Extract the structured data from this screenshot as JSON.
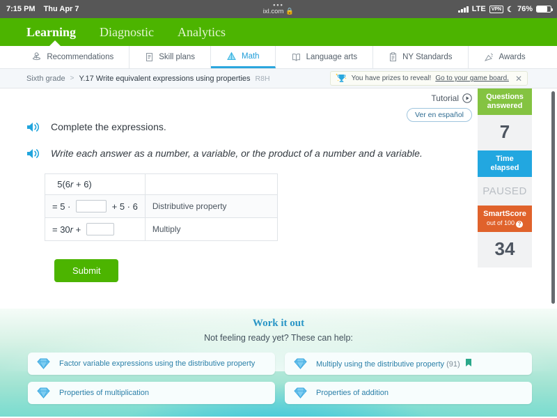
{
  "status_bar": {
    "time": "7:15 PM",
    "date": "Thu Apr 7",
    "url": "ixl.com",
    "lock_icon": "🔒",
    "network": "LTE",
    "vpn": "VPN",
    "moon_icon": "☾",
    "battery": "76%"
  },
  "top_nav": {
    "items": [
      {
        "label": "Learning",
        "active": true
      },
      {
        "label": "Diagnostic",
        "active": false
      },
      {
        "label": "Analytics",
        "active": false
      }
    ]
  },
  "subject_tabs": [
    {
      "label": "Recommendations",
      "icon": "recommendations-icon",
      "active": false
    },
    {
      "label": "Skill plans",
      "icon": "skill-plans-icon",
      "active": false
    },
    {
      "label": "Math",
      "icon": "math-icon",
      "active": true
    },
    {
      "label": "Language arts",
      "icon": "language-arts-icon",
      "active": false
    },
    {
      "label": "NY Standards",
      "icon": "standards-icon",
      "active": false
    },
    {
      "label": "Awards",
      "icon": "awards-icon",
      "active": false
    }
  ],
  "breadcrumb": {
    "grade": "Sixth grade",
    "separator": ">",
    "skill": "Y.17 Write equivalent expressions using properties",
    "code": "R8H"
  },
  "prize_banner": {
    "icon": "trophy-icon",
    "text": "You have prizes to reveal!",
    "link": "Go to your game board.",
    "close": "✕"
  },
  "tutorial": {
    "label": "Tutorial",
    "play_icon": "play-circle-icon",
    "spanish_label": "Ver en español"
  },
  "stats": [
    {
      "title": "Questions",
      "title2": "answered",
      "value": "7",
      "color": "#84c341",
      "paused": false
    },
    {
      "title": "Time",
      "title2": "elapsed",
      "value": "PAUSED",
      "color": "#22a7e0",
      "paused": true
    },
    {
      "title": "SmartScore",
      "subtitle": "out of 100",
      "value": "34",
      "color": "#e0622b",
      "paused": false
    }
  ],
  "question": {
    "line1": "Complete the expressions.",
    "line2": "Write each answer as a number, a variable, or the product of a number and a variable.",
    "speaker_icon": "speaker-icon",
    "table": {
      "row1_expr_pre": "5(6",
      "row1_var": "r",
      "row1_expr_post": " + 6)",
      "row1_label": "",
      "row2_pre": "= 5 · ",
      "row2_mid": " + 5 · 6",
      "row2_label": "Distributive property",
      "row3_pre": "= 30",
      "row3_var": "r",
      "row3_mid": " + ",
      "row3_label": "Multiply",
      "blank_value": ""
    },
    "submit_label": "Submit"
  },
  "scratchpad": {
    "icon": "pencil-icon"
  },
  "work_it_out": {
    "title": "Work it out",
    "subtitle": "Not feeling ready yet? These can help:",
    "cards": [
      {
        "label": "Factor variable expressions using the distributive property",
        "count": "",
        "bookmark": false
      },
      {
        "label": "Multiply using the distributive property",
        "count": "(91)",
        "bookmark": true
      },
      {
        "label": "Properties of multiplication",
        "count": "",
        "bookmark": false
      },
      {
        "label": "Properties of addition",
        "count": "",
        "bookmark": false
      }
    ]
  },
  "colors": {
    "brand_green": "#4cb400",
    "accent_blue": "#2ba6de",
    "orange": "#e0622b"
  }
}
